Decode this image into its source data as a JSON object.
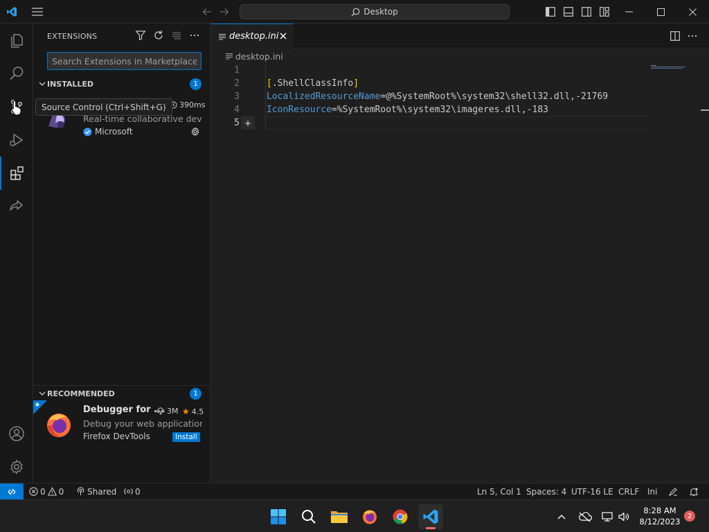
{
  "titlebar": {
    "search_label": "Desktop"
  },
  "sidebar": {
    "title": "EXTENSIONS",
    "search_placeholder": "Search Extensions in Marketplace",
    "installed": {
      "header": "INSTALLED",
      "count": "1",
      "items": [
        {
          "description": "Real-time collaborative dev...",
          "publisher": "Microsoft",
          "activation_time": "390ms"
        }
      ]
    },
    "recommended": {
      "header": "RECOMMENDED",
      "count": "1",
      "items": [
        {
          "name": "Debugger for ...",
          "downloads": "3M",
          "rating": "4.5",
          "description": "Debug your web application...",
          "publisher": "Firefox DevTools",
          "install_label": "Install"
        }
      ]
    }
  },
  "tooltip": {
    "text": "Source Control (Ctrl+Shift+G)"
  },
  "editor": {
    "tab_label": "desktop.ini",
    "breadcrumb": "desktop.ini",
    "line_numbers": [
      "1",
      "2",
      "3",
      "4",
      "5"
    ],
    "lines": {
      "l2_open": "[",
      "l2_text": ".ShellClassInfo",
      "l2_close": "]",
      "l3_key": "LocalizedResourceName",
      "l3_value": "=@%SystemRoot%\\system32\\shell32.dll,-21769",
      "l4_key": "IconResource",
      "l4_value": "=%SystemRoot%\\system32\\imageres.dll,-183"
    }
  },
  "statusbar": {
    "errors": "0",
    "warnings": "0",
    "shared": "Shared",
    "ports": "0",
    "position": "Ln 5, Col 1",
    "spaces": "Spaces: 4",
    "encoding": "UTF-16 LE",
    "eol": "CRLF",
    "language": "Ini"
  },
  "taskbar": {
    "time": "8:28 AM",
    "date": "8/12/2023",
    "notifications": "2"
  },
  "colors": {
    "accent": "#0078d4",
    "editor_bg": "#1f1f1f",
    "sidebar_bg": "#181818",
    "key_blue": "#569cd6",
    "bracket_gold": "#ffd700"
  }
}
